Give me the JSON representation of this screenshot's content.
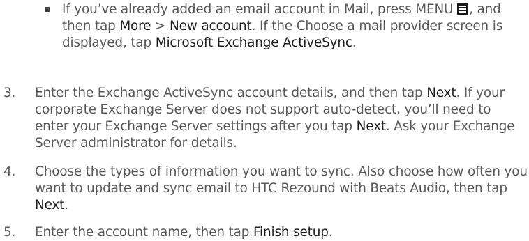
{
  "bullet": {
    "part1": "If you’ve already added an email account in Mail, press MENU",
    "part2": ", and then tap",
    "more": "More",
    "gt": ">",
    "new_account": "New account",
    "part3": ". If the Choose a mail provider screen is displayed, tap",
    "exchange": "Microsoft Exchange ActiveSync",
    "end": ".",
    "menu_icon": "menu-icon"
  },
  "steps": [
    {
      "number": "3.",
      "part1": "Enter the Exchange ActiveSync account details, and then tap",
      "next1": "Next",
      "part2": ". If your corporate Exchange Server does not support auto-detect, you’ll need to enter your Exchange Server settings after you tap",
      "next2": "Next",
      "part3": ". Ask your Exchange Server administrator for details."
    },
    {
      "number": "4.",
      "part1": "Choose the types of information you want to sync. Also choose how often you want to update and sync email to HTC Rezound with Beats Audio, then tap",
      "next": "Next",
      "part2": "."
    },
    {
      "number": "5.",
      "part1": "Enter the account name, then tap",
      "finish": "Finish setup",
      "part2": "."
    }
  ]
}
